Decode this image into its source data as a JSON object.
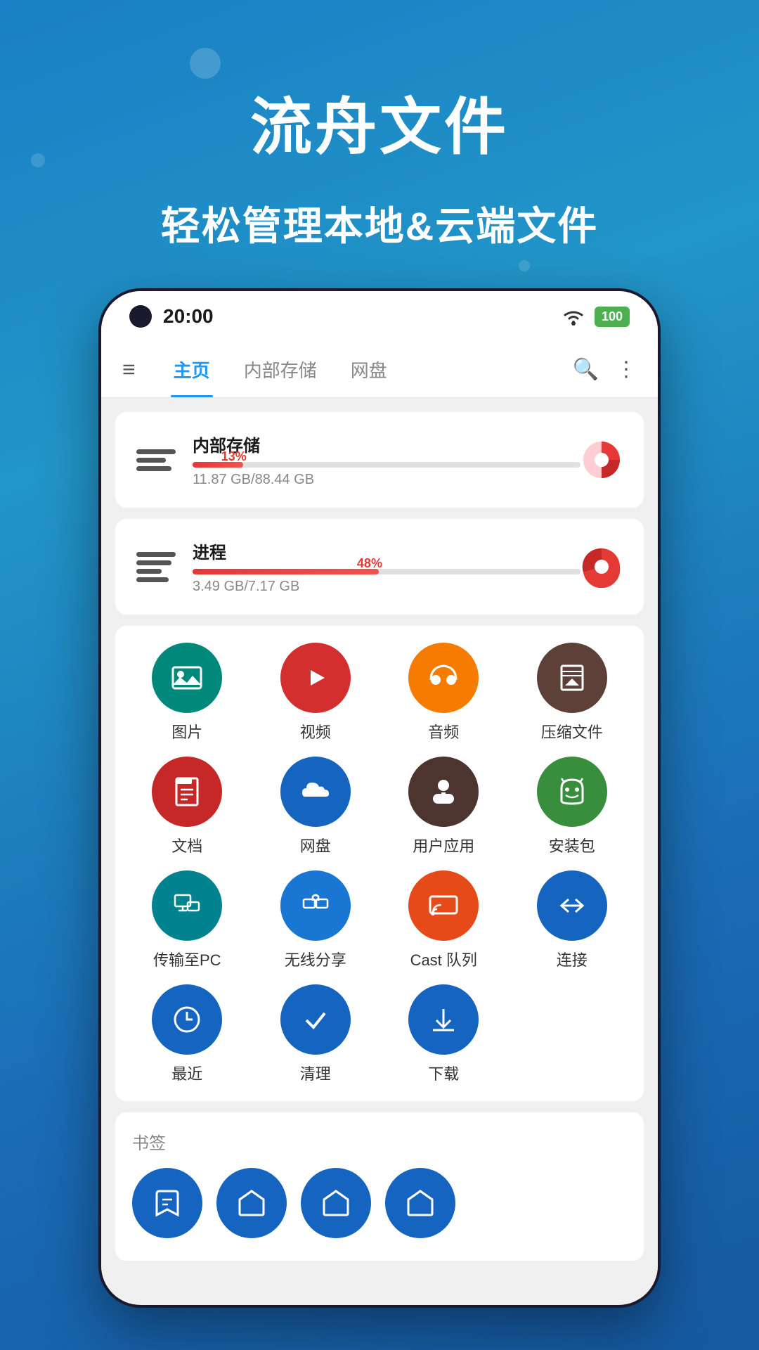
{
  "app": {
    "title": "流舟文件",
    "subtitle": "轻松管理本地&云端文件"
  },
  "status_bar": {
    "time": "20:00",
    "battery_label": "100"
  },
  "nav": {
    "tab_home": "主页",
    "tab_internal": "内部存储",
    "tab_cloud": "网盘"
  },
  "storage_internal": {
    "name": "内部存储",
    "percent": 13,
    "percent_label": "13%",
    "size": "11.87 GB/88.44 GB"
  },
  "storage_process": {
    "name": "进程",
    "percent": 48,
    "percent_label": "48%",
    "size": "3.49 GB/7.17 GB"
  },
  "icons": [
    {
      "id": "photos",
      "label": "图片",
      "color_class": "ic-teal",
      "symbol": "🖼"
    },
    {
      "id": "video",
      "label": "视频",
      "color_class": "ic-red",
      "symbol": "▶"
    },
    {
      "id": "audio",
      "label": "音频",
      "color_class": "ic-orange",
      "symbol": "🎧"
    },
    {
      "id": "archive",
      "label": "压缩文件",
      "color_class": "ic-brown",
      "symbol": "📦"
    },
    {
      "id": "docs",
      "label": "文档",
      "color_class": "ic-red2",
      "symbol": "📄"
    },
    {
      "id": "cloud",
      "label": "网盘",
      "color_class": "ic-blue",
      "symbol": "☁"
    },
    {
      "id": "apps",
      "label": "用户应用",
      "color_class": "ic-dark-brown",
      "symbol": "🤖"
    },
    {
      "id": "apk",
      "label": "安装包",
      "color_class": "ic-green",
      "symbol": "🤖"
    },
    {
      "id": "transfer-pc",
      "label": "传输至PC",
      "color_class": "ic-teal2",
      "symbol": "💻"
    },
    {
      "id": "wireless",
      "label": "无线分享",
      "color_class": "ic-blue2",
      "symbol": "📡"
    },
    {
      "id": "cast",
      "label": "Cast 队列",
      "color_class": "ic-orange2",
      "symbol": "📺"
    },
    {
      "id": "connect",
      "label": "连接",
      "color_class": "ic-blue3",
      "symbol": "↔"
    },
    {
      "id": "recent",
      "label": "最近",
      "color_class": "ic-blue4",
      "symbol": "🕐"
    },
    {
      "id": "clean",
      "label": "清理",
      "color_class": "ic-blue5",
      "symbol": "✔"
    },
    {
      "id": "download",
      "label": "下载",
      "color_class": "ic-blue6",
      "symbol": "⬇"
    }
  ],
  "bookmarks": {
    "title": "书签",
    "items": [
      {
        "symbol": "⬇"
      },
      {
        "symbol": "📁"
      },
      {
        "symbol": "📁"
      },
      {
        "symbol": "📁"
      }
    ]
  }
}
